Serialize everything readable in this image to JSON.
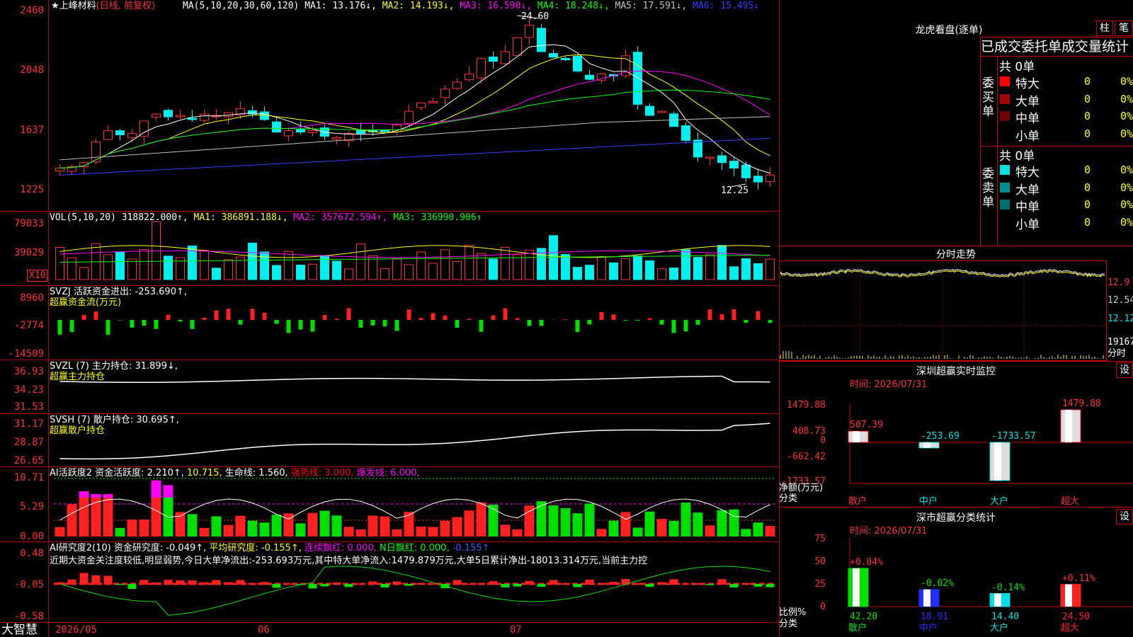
{
  "stock": {
    "name": "★上峰材料",
    "mode": "(日线, 前复权)",
    "ma_labels": [
      {
        "text": "MA(5,10,20,30,60,120)",
        "color": "#ffffff"
      },
      {
        "text": "MA1: 13.176↓,",
        "color": "#ffffff"
      },
      {
        "text": "MA2: 14.193↓,",
        "color": "#ffff00"
      },
      {
        "text": "MA3: 16.590↓,",
        "color": "#ff00ff"
      },
      {
        "text": "MA4: 18.248↓,",
        "color": "#00ff00"
      },
      {
        "text": "MA5: 17.591↓,",
        "color": "#c0c0c0"
      },
      {
        "text": "MA6: 15.495↓",
        "color": "#3040ff"
      }
    ],
    "high_mark": "24.60",
    "low_mark": "12.25"
  },
  "axes": {
    "price": [
      "2460",
      "2048",
      "1637",
      "1225"
    ],
    "vol": [
      "79033",
      "39029"
    ],
    "vol_unit": "X10",
    "svzj": [
      "8960",
      "-2774",
      "-14509"
    ],
    "svzl": [
      "36.93",
      "34.23",
      "31.53"
    ],
    "svsh": [
      "31.17",
      "28.87",
      "26.65"
    ],
    "ai": [
      "10.71",
      "5.29",
      "0.00"
    ],
    "ai2": [
      "0.48",
      "-0.05",
      "-0.58"
    ],
    "dates": [
      "2026/05",
      "06",
      "07"
    ]
  },
  "panels": {
    "vol": [
      {
        "text": "VOL(5,10,20)",
        "color": "#ffffff"
      },
      {
        "text": "318822.000↑,",
        "color": "#ffffff"
      },
      {
        "text": "MA1: 386891.188↓,",
        "color": "#ffff00"
      },
      {
        "text": "MA2: 357672.594↑,",
        "color": "#ff00ff"
      },
      {
        "text": "MA3: 336990.906↑",
        "color": "#00ff00"
      }
    ],
    "svzj_line1": "SVZJ  活跃资金进出: -253.690↑,",
    "svzj_line2": "超赢资金流(万元)",
    "svzl_line1": "SVZL (7) 主力持仓: 31.899↓,",
    "svzl_line2": "超赢主力持仓",
    "svsh_line1": "SVSH (7) 散户持仓: 30.695↑,",
    "svsh_line2": "超赢散户持仓",
    "ai": [
      {
        "text": "AI活跃度2 资金活跃度: 2.210↑,",
        "color": "#ffffff"
      },
      {
        "text": "10.715,",
        "color": "#ffff00"
      },
      {
        "text": "生命线: 1.560,",
        "color": "#ffffff"
      },
      {
        "text": "强势线: 3.000,",
        "color": "#ff0000"
      },
      {
        "text": "爆发线: 6.000,",
        "color": "#ff00ff"
      }
    ],
    "ai2": [
      {
        "text": "AI研究度2(10) 资金研究度: -0.049↑,",
        "color": "#ffffff"
      },
      {
        "text": "平均研究度: -0.155↑,",
        "color": "#ffff00"
      },
      {
        "text": "连续飘红: 0.000,",
        "color": "#ff00ff"
      },
      {
        "text": "N日飘红: 0.000,",
        "color": "#00ff00"
      },
      {
        "text": "-0.155↑",
        "color": "#3060ff"
      }
    ],
    "ai2_note": "近期大资金关注度较低,明显弱势,今日大单净流出:-253.693万元,其中特大单净流入:1479.879万元,大单5日累计净出-18013.314万元,当前主力控"
  },
  "brand": "大智慧",
  "dragon": {
    "title": "龙虎看盘(逐单)",
    "tab_bar": "柱",
    "tab_pen": "笔",
    "tabs": [
      "已成交",
      "委托单",
      "成交量统计"
    ],
    "buy_label": "委买单",
    "sell_label": "委卖单",
    "buy_total": "共 0单",
    "sell_total": "共 0单",
    "rows": [
      {
        "label": "特大",
        "color": "#ff0000",
        "count": "0",
        "pct": "0%"
      },
      {
        "label": "大单",
        "color": "#a00000",
        "count": "0",
        "pct": "0%"
      },
      {
        "label": "中单",
        "color": "#700000",
        "count": "0",
        "pct": "0%"
      },
      {
        "label": "小单",
        "color": "#000000",
        "count": "0",
        "pct": "0%"
      }
    ],
    "sell_rows": [
      {
        "label": "特大",
        "color": "#00e0e0",
        "count": "0",
        "pct": "0%"
      },
      {
        "label": "大单",
        "color": "#008c8c",
        "count": "0",
        "pct": "0%"
      },
      {
        "label": "中单",
        "color": "#007070",
        "count": "0",
        "pct": "0%"
      },
      {
        "label": "小单",
        "color": "#000000",
        "count": "0",
        "pct": "0%"
      }
    ]
  },
  "intraday": {
    "title": "分时走势",
    "prices": [
      "12.9",
      "12.54",
      "12.12"
    ],
    "vol_top": "19167",
    "vol_unit": "分时"
  },
  "sz_monitor": {
    "title": "深圳超赢实时监控",
    "set": "设",
    "time": "时间: 2026/07/31",
    "ylabels": [
      "1479.88",
      "408.73",
      "0",
      "-662.42",
      "-1733.57"
    ],
    "unit": "净额(万元)",
    "cat_label": "分类",
    "categories": [
      "散户",
      "中户",
      "大户",
      "超大"
    ],
    "values": [
      507.39,
      -253.69,
      -1733.57,
      1479.88
    ],
    "value_labels": [
      "507.39",
      "-253.69",
      "-1733.57",
      "1479.88"
    ]
  },
  "sz_class": {
    "title": "深市超赢分类统计",
    "set": "设",
    "time": "时间: 2026/07/31",
    "ylabels": [
      "75",
      "50",
      "25",
      "0"
    ],
    "unit": "比例%",
    "cat_label": "分类",
    "categories": [
      "散户",
      "中户",
      "大户",
      "超大"
    ],
    "values": [
      42.2,
      18.91,
      14.4,
      24.5
    ],
    "value_labels": [
      "42.20",
      "18.91",
      "14.40",
      "24.50"
    ],
    "changes": [
      "+0.04%",
      "-0.02%",
      "-0.14%",
      "+0.11%"
    ]
  }
}
